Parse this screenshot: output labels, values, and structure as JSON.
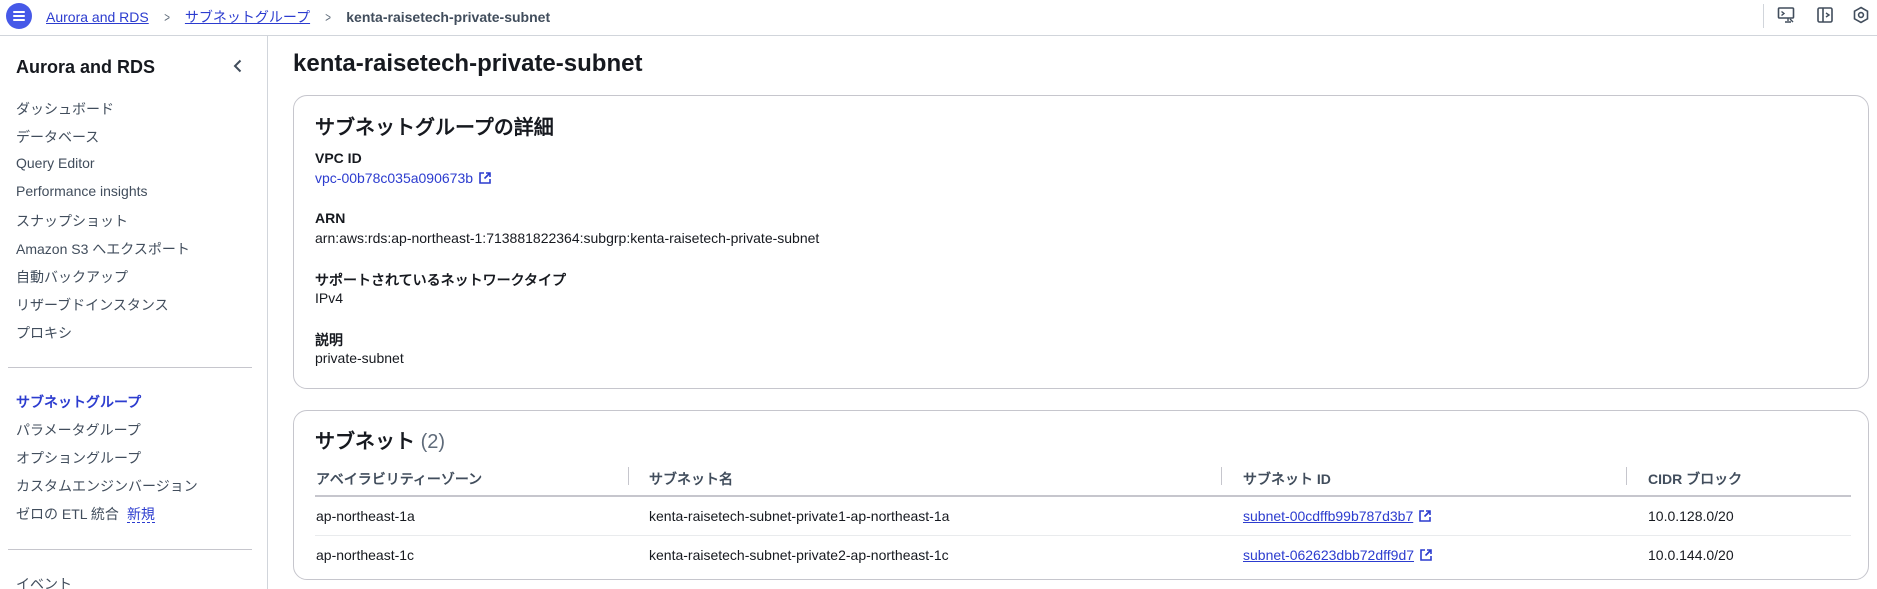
{
  "breadcrumbs": [
    "Aurora and RDS",
    "サブネットグループ",
    "kenta-raisetech-private-subnet"
  ],
  "sidebar": {
    "title": "Aurora and RDS",
    "items": [
      {
        "label": "ダッシュボード"
      },
      {
        "label": "データベース"
      },
      {
        "label": "Query Editor"
      },
      {
        "label": "Performance insights"
      },
      {
        "label": "スナップショット"
      },
      {
        "label": "Amazon S3 へエクスポート"
      },
      {
        "label": "自動バックアップ"
      },
      {
        "label": "リザーブドインスタンス"
      },
      {
        "label": "プロキシ"
      }
    ],
    "items2": [
      {
        "label": "サブネットグループ",
        "active": true
      },
      {
        "label": "パラメータグループ"
      },
      {
        "label": "オプショングループ"
      },
      {
        "label": "カスタムエンジンバージョン"
      },
      {
        "label": "ゼロの ETL 統合",
        "badge": "新規"
      }
    ],
    "items3": [
      {
        "label": "イベント"
      }
    ]
  },
  "page": {
    "title": "kenta-raisetech-private-subnet"
  },
  "details": {
    "heading": "サブネットグループの詳細",
    "vpc_label": "VPC ID",
    "vpc_value": "vpc-00b78c035a090673b",
    "arn_label": "ARN",
    "arn_value": "arn:aws:rds:ap-northeast-1:713881822364:subgrp:kenta-raisetech-private-subnet",
    "network_label": "サポートされているネットワークタイプ",
    "network_value": "IPv4",
    "desc_label": "説明",
    "desc_value": "private-subnet"
  },
  "subnets": {
    "heading": "サブネット",
    "count": "(2)",
    "columns": [
      "アベイラビリティーゾーン",
      "サブネット名",
      "サブネット ID",
      "CIDR ブロック"
    ],
    "rows": [
      {
        "az": "ap-northeast-1a",
        "name": "kenta-raisetech-subnet-private1-ap-northeast-1a",
        "id": "subnet-00cdffb99b787d3b7",
        "cidr": "10.0.128.0/20"
      },
      {
        "az": "ap-northeast-1c",
        "name": "kenta-raisetech-subnet-private2-ap-northeast-1c",
        "id": "subnet-062623dbb72dff9d7",
        "cidr": "10.0.144.0/20"
      }
    ]
  },
  "icons": {
    "menu": "hamburger-menu-icon",
    "cloudshell": "cloudshell-icon",
    "notifications": "panel-icon",
    "settings": "settings-hex-icon",
    "external": "external-link-icon"
  },
  "colors": {
    "accent": "#4659e8",
    "link": "#2c3ccf",
    "border": "#c6c6cd"
  }
}
